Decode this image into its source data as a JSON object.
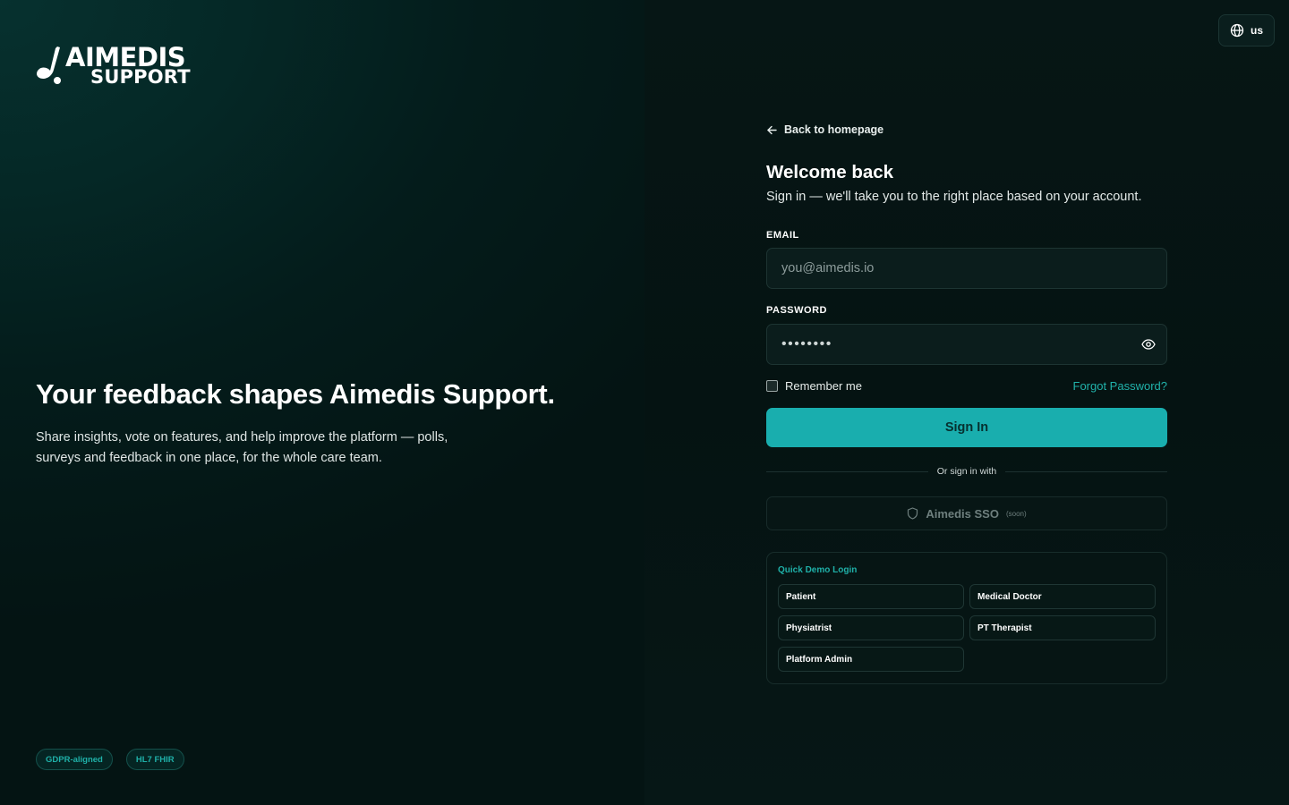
{
  "brand": {
    "line1": "AIMEDIS",
    "line2": "SUPPORT"
  },
  "hero": {
    "title": "Your feedback shapes Aimedis Support.",
    "subtitle": "Share insights, vote on features, and help improve the platform — polls, surveys and feedback in one place, for the whole care team."
  },
  "badges": [
    "GDPR-aligned",
    "HL7 FHIR"
  ],
  "language": {
    "label": "us",
    "icon": "globe-icon"
  },
  "form": {
    "back_label": "Back to homepage",
    "title": "Welcome back",
    "subtitle": "Sign in — we'll take you to the right place based on your account.",
    "email": {
      "label": "EMAIL",
      "placeholder": "you@aimedis.io",
      "value": ""
    },
    "password": {
      "label": "PASSWORD",
      "value": "••••••••"
    },
    "remember_label": "Remember me",
    "remember_checked": false,
    "forgot_label": "Forgot Password?",
    "submit_label": "Sign In",
    "divider_label": "Or sign in with",
    "sso": {
      "label": "Aimedis SSO",
      "tag": "(soon)"
    }
  },
  "demo": {
    "title": "Quick Demo Login",
    "roles": [
      "Patient",
      "Medical Doctor",
      "Physiatrist",
      "PT Therapist",
      "Platform Admin"
    ]
  },
  "colors": {
    "accent": "#19aeae",
    "accent_text": "#21b3ab",
    "background_left": "#052826",
    "background_right": "#061615"
  }
}
